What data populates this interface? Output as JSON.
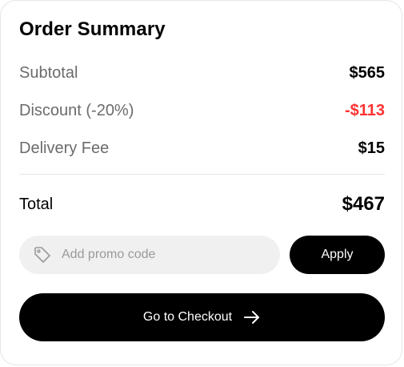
{
  "order_summary": {
    "title": "Order Summary",
    "rows": {
      "subtotal": {
        "label": "Subtotal",
        "value": "$565"
      },
      "discount": {
        "label": "Discount (-20%)",
        "value": "-$113"
      },
      "delivery": {
        "label": "Delivery Fee",
        "value": "$15"
      }
    },
    "total": {
      "label": "Total",
      "value": "$467"
    },
    "promo": {
      "placeholder": "Add promo code",
      "value": "",
      "icon": "tag-icon",
      "apply_label": "Apply"
    },
    "checkout": {
      "label": "Go to Checkout",
      "icon": "arrow-right-icon"
    }
  },
  "colors": {
    "discount": "#ff3333",
    "primary_button": "#000000",
    "promo_background": "#f0f0f0",
    "muted_text": "#6b6b6b",
    "border": "#e6e6e6"
  }
}
